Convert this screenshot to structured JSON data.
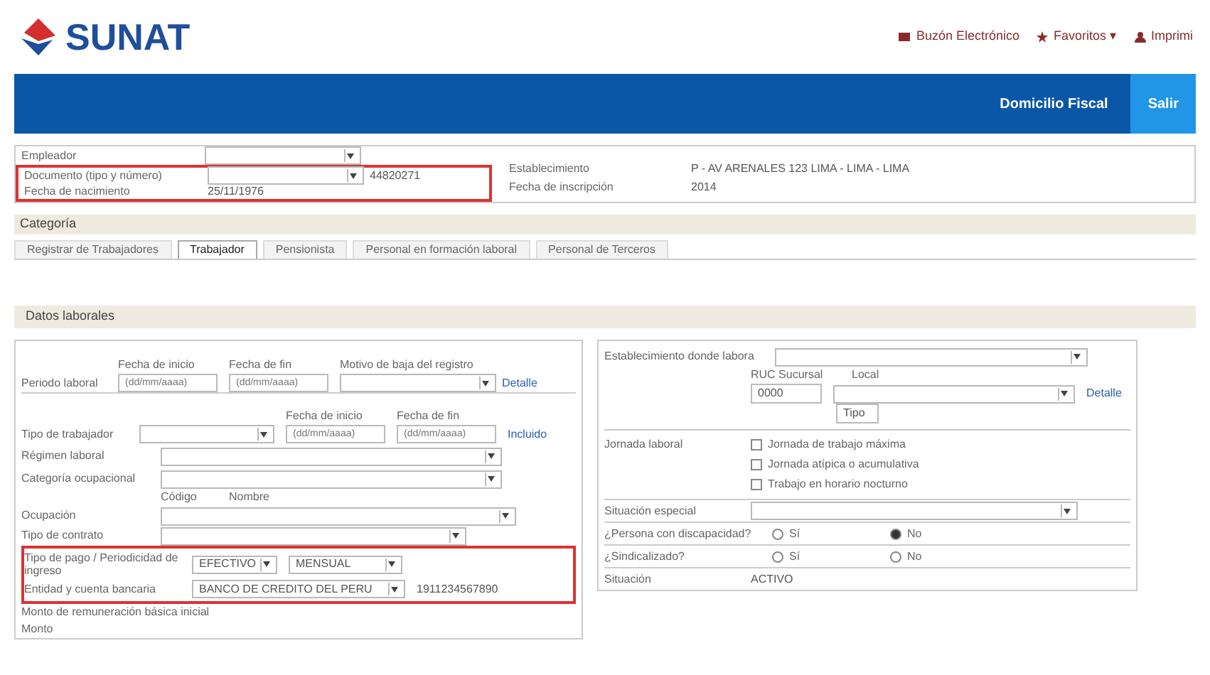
{
  "header": {
    "logo": "SUNAT",
    "links": [
      {
        "label": "Buzón Electrónico"
      },
      {
        "label": "Favoritos ▾"
      },
      {
        "label": "Imprimi"
      }
    ]
  },
  "bar": {
    "user": "Domicilio Fiscal",
    "button": "Salir"
  },
  "top": {
    "left": [
      {
        "label": "Empleador"
      },
      {
        "label": "Documento (tipo y número)",
        "extra": "44820271"
      },
      {
        "label": "Fecha de nacimiento",
        "value": "25/11/1976"
      }
    ],
    "right": [
      {
        "label": "Establecimiento",
        "value": "P - AV ARENALES 123 LIMA - LIMA - LIMA"
      },
      {
        "label": "Fecha de inscripción",
        "value": "2014"
      }
    ]
  },
  "category": {
    "title": "Categoría",
    "tabs": [
      {
        "label": "Registrar de Trabajadores",
        "selected": false
      },
      {
        "label": "Trabajador",
        "selected": true
      },
      {
        "label": "Pensionista",
        "selected": false
      },
      {
        "label": "Personal en formación laboral",
        "selected": false
      },
      {
        "label": "Personal de Terceros",
        "selected": false
      }
    ]
  },
  "section": "Datos laborales",
  "period": {
    "heads": [
      "Fecha de inicio",
      "Fecha de fin",
      "Motivo de baja del registro"
    ],
    "placeholders": [
      "(dd/mm/aaaa)",
      "(dd/mm/aaaa)"
    ],
    "label": "Periodo laboral",
    "link": "Detalle"
  },
  "worker": {
    "heads": [
      "Fecha de inicio",
      "Fecha de fin"
    ],
    "placeholders": [
      "(dd/mm/aaaa)",
      "(dd/mm/aaaa)"
    ],
    "label": "Tipo de trabajador",
    "link": "Incluido"
  },
  "selects": [
    {
      "label": "Régimen laboral"
    },
    {
      "label": "Categoría ocupacional"
    }
  ],
  "occupation": {
    "heads": [
      "Código",
      "Nombre"
    ],
    "label": "Ocupación"
  },
  "contract": {
    "label": "Tipo de contrato"
  },
  "payment": {
    "label": "Tipo de pago / Periodicidad de ingreso",
    "values": [
      "EFECTIVO",
      "MENSUAL"
    ]
  },
  "bank": {
    "label": "Entidad y cuenta bancaria",
    "value": "BANCO DE CREDITO DEL PERU",
    "account": "1911234567890"
  },
  "salary": {
    "label": "Monto de remuneración básica inicial",
    "sub": "Monto"
  },
  "establishment": {
    "label": "Establecimiento donde labora",
    "heads": [
      "RUC Sucursal",
      "Local"
    ],
    "code": "0000",
    "type": "Tipo",
    "link": "Detalle"
  },
  "schedule": {
    "label": "Jornada laboral",
    "options": [
      {
        "label": "Jornada de trabajo máxima",
        "checked": false
      },
      {
        "label": "Jornada atípica o acumulativa",
        "checked": false
      },
      {
        "label": "Trabajo en horario nocturno",
        "checked": false
      }
    ]
  },
  "special": {
    "label": "Situación especial"
  },
  "radios": [
    {
      "label": "¿Persona con discapacidad?",
      "options": [
        {
          "label": "Sí",
          "selected": false
        },
        {
          "label": "No",
          "selected": true
        }
      ]
    },
    {
      "label": "¿Sindicalizado?",
      "options": [
        {
          "label": "Sí",
          "selected": false
        },
        {
          "label": "No",
          "selected": false
        }
      ]
    }
  ],
  "status": {
    "label": "Situación",
    "value": "ACTIVO"
  }
}
